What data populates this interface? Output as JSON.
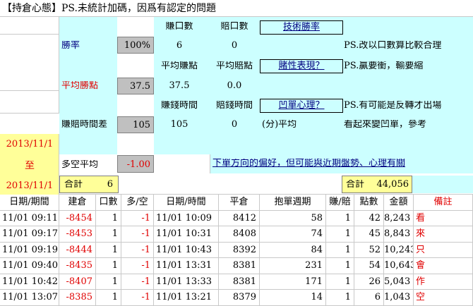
{
  "header": {
    "title": "【持倉心態】PS.未統計加碼，因爲有認定的問題"
  },
  "summary": {
    "col_profit_count": "賺口數",
    "col_loss_count": "賠口數",
    "link_technical": "技術勝率",
    "win_rate_label": "勝率",
    "win_rate_value": "100%",
    "profit_count": "6",
    "loss_count": "0",
    "note1": "PS.改以口數算比較合理",
    "col_avg_profit": "平均賺點",
    "col_avg_loss": "平均賠點",
    "link_gamble": "賭性表現？",
    "note2": "PS.贏要衝，輸要縮",
    "avg_win_label": "平均勝點",
    "avg_win_value": "37.5",
    "avg_profit": "37.5",
    "avg_loss": "0.0",
    "col_profit_time": "賺錢時間",
    "col_loss_time": "賠錢時間",
    "link_dip": "凹單心理？",
    "note3": "PS.有可能是反轉才出場",
    "time_diff_label": "賺賠時間差",
    "time_diff_value": "105",
    "profit_time": "105",
    "loss_time": "0",
    "avg_unit": "(分)平均",
    "note4": "看起來變凹單，參考",
    "date_from": "2013/11/1",
    "date_to_label": "至",
    "date_to": "2013/11/1",
    "long_short_label": "多空平均",
    "long_short_value": "-1.00",
    "bias_link": "下單方向的偏好，但可能與近期盤勢、心理有關",
    "total_label": "合計",
    "total_count": "6",
    "total_amount_label": "合計",
    "total_amount": "44,056"
  },
  "table": {
    "headers": [
      "日期/期間",
      "建倉",
      "口數",
      "多/空",
      "日期/時間",
      "平倉",
      "抱單週期",
      "賺/賠",
      "點數",
      "金額",
      "備註"
    ],
    "rows": [
      [
        "11/01 09:11",
        "-8454",
        "1",
        "-1",
        "11/01 10:09",
        "8412",
        "58",
        "1",
        "42",
        "8,243",
        "看"
      ],
      [
        "11/01 09:17",
        "-8453",
        "1",
        "-1",
        "11/01 10:31",
        "8408",
        "74",
        "1",
        "45",
        "8,843",
        "來"
      ],
      [
        "11/01 09:19",
        "-8444",
        "1",
        "-1",
        "11/01 10:43",
        "8392",
        "84",
        "1",
        "52",
        "10,243",
        "只"
      ],
      [
        "11/01 09:40",
        "-8435",
        "1",
        "-1",
        "11/01 13:31",
        "8381",
        "231",
        "1",
        "54",
        "10,643",
        "會"
      ],
      [
        "11/01 10:42",
        "-8407",
        "1",
        "-1",
        "11/01 13:33",
        "8381",
        "171",
        "1",
        "26",
        "5,043",
        "作"
      ],
      [
        "11/01 13:07",
        "-8385",
        "1",
        "-1",
        "11/01 13:21",
        "8379",
        "14",
        "1",
        "6",
        "1,043",
        "空"
      ]
    ]
  }
}
